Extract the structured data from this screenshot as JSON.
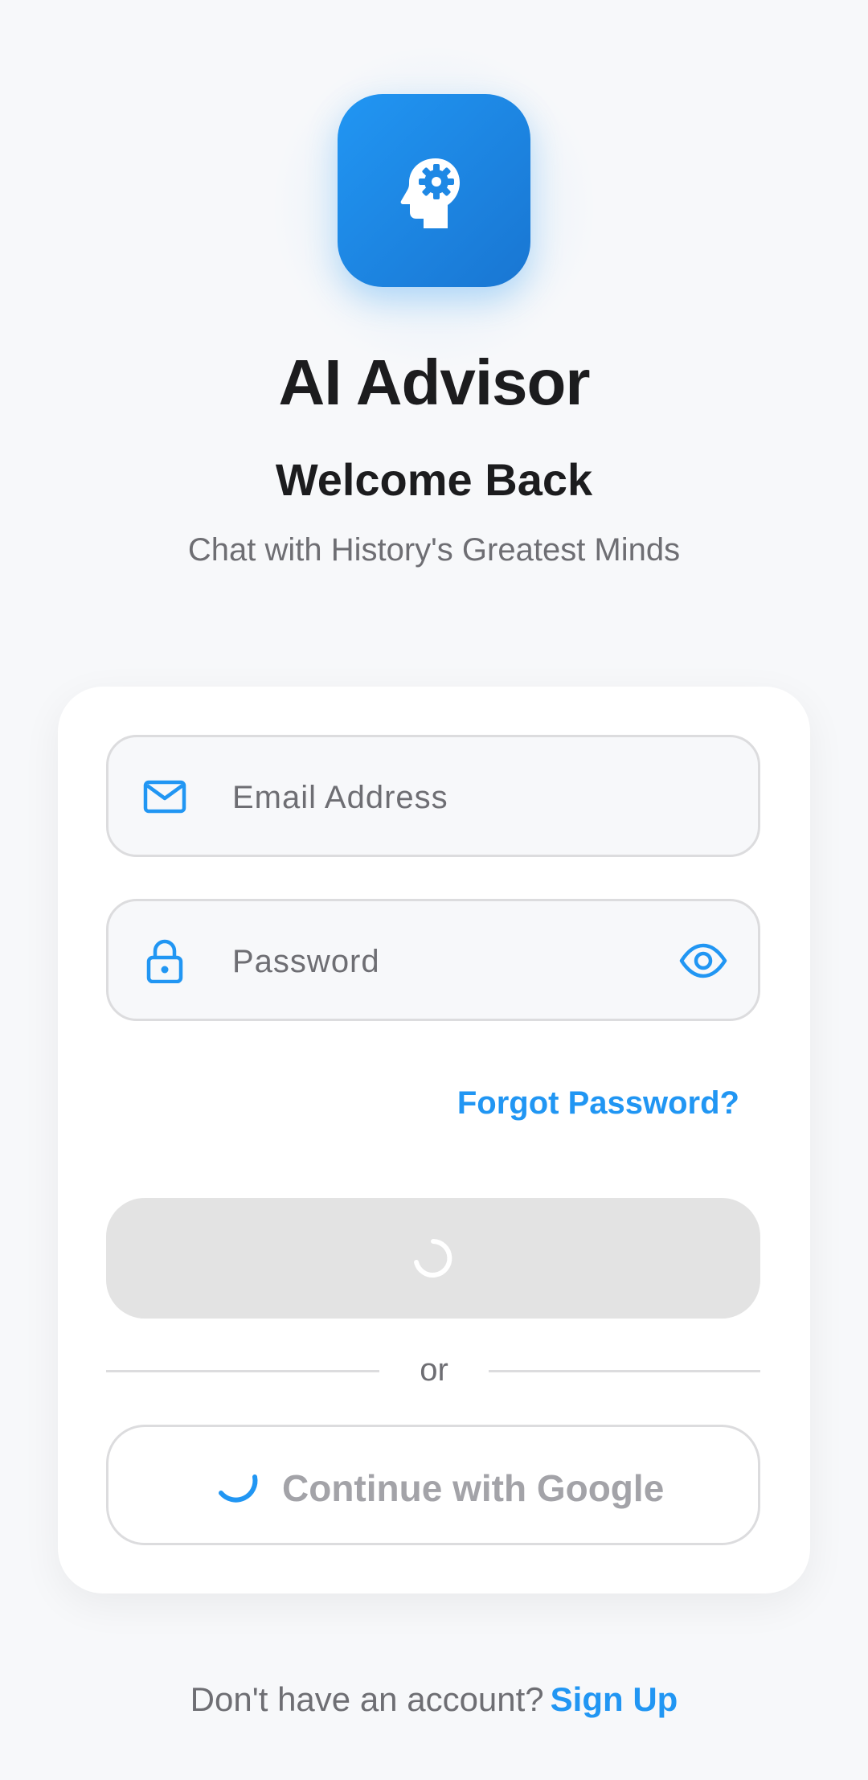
{
  "colors": {
    "accent": "#2196f3",
    "accent_dark": "#1976d2",
    "background": "#f7f8fa",
    "card": "#ffffff",
    "text_primary": "#1c1c1e",
    "text_secondary": "#6e6e73",
    "disabled_button": "#e3e3e3"
  },
  "header": {
    "logo_icon": "head-gear-icon",
    "app_title": "AI Advisor",
    "welcome": "Welcome Back",
    "tagline": "Chat with History's Greatest Minds"
  },
  "form": {
    "email": {
      "icon": "mail-icon",
      "placeholder": "Email Address",
      "value": ""
    },
    "password": {
      "icon": "lock-icon",
      "placeholder": "Password",
      "value": "",
      "toggle_icon": "eye-icon"
    },
    "forgot_password": "Forgot Password?",
    "signin_loading_icon": "loading-spinner-icon",
    "divider_text": "or",
    "google": {
      "icon": "loading-spinner-icon",
      "label": "Continue with Google"
    }
  },
  "footer": {
    "prompt": "Don't have an account?",
    "signup_label": "Sign Up"
  }
}
